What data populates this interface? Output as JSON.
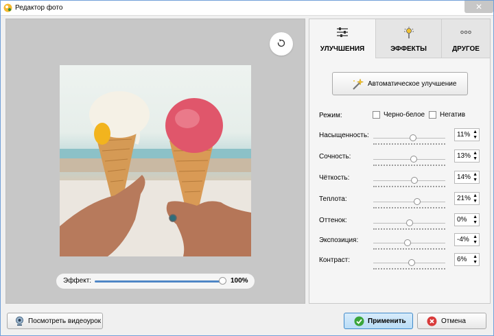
{
  "window": {
    "title": "Редактор фото",
    "close_label": "✕"
  },
  "preview": {
    "effect_label": "Эффект:",
    "effect_value": "100%",
    "effect_level": 1.0
  },
  "tabs": [
    {
      "label": "УЛУЧШЕНИЯ",
      "icon": "sliders-icon",
      "active": true
    },
    {
      "label": "ЭФФЕКТЫ",
      "icon": "magic-sparkle-icon",
      "active": false
    },
    {
      "label": "ДРУГОЕ",
      "icon": "more-dots-icon",
      "active": false
    }
  ],
  "auto_button": {
    "label": "Автоматическое улучшение",
    "icon": "magic-wand-icon"
  },
  "mode": {
    "label": "Режим:",
    "options": [
      {
        "label": "Черно-белое",
        "checked": false
      },
      {
        "label": "Негатив",
        "checked": false
      }
    ]
  },
  "sliders": [
    {
      "label": "Насыщенность:",
      "value": "11%",
      "number": 11
    },
    {
      "label": "Сочность:",
      "value": "13%",
      "number": 13
    },
    {
      "label": "Чёткость:",
      "value": "14%",
      "number": 14
    },
    {
      "label": "Теплота:",
      "value": "21%",
      "number": 21
    },
    {
      "label": "Оттенок:",
      "value": "0%",
      "number": 0
    },
    {
      "label": "Экспозиция:",
      "value": "-4%",
      "number": -4
    },
    {
      "label": "Контраст:",
      "value": "6%",
      "number": 6
    }
  ],
  "footer": {
    "video_label": "Посмотреть видеоурок",
    "apply_label": "Применить",
    "cancel_label": "Отмена"
  },
  "colors": {
    "accent": "#4f86c6",
    "preview_bg": "#c7c7c7",
    "apply_green": "#3aa53a",
    "cancel_red": "#d93b3b"
  }
}
